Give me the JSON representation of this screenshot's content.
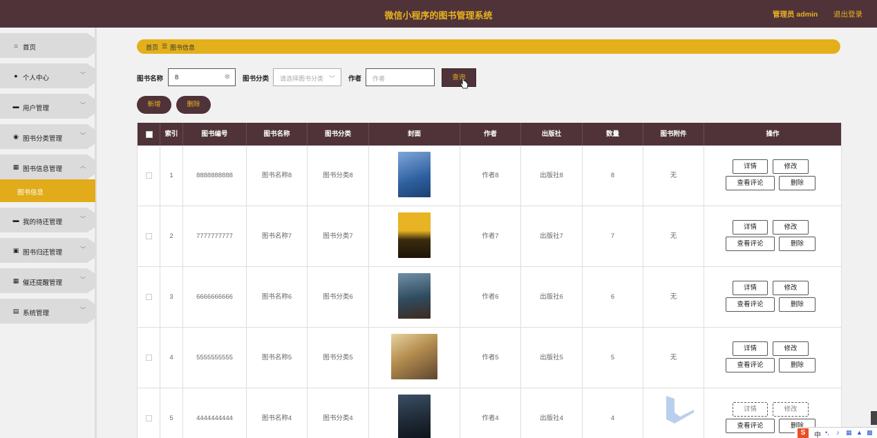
{
  "header": {
    "title": "微信小程序的图书管理系统",
    "admin_label": "管理员 admin",
    "logout_label": "退出登录"
  },
  "sidebar": {
    "items": [
      {
        "label": "首页",
        "icon": "home-icon",
        "glyph": "⌂",
        "has_chevron": false
      },
      {
        "label": "个人中心",
        "icon": "user-icon",
        "glyph": "●",
        "has_chevron": true
      },
      {
        "label": "用户管理",
        "icon": "monitor-icon",
        "glyph": "▬",
        "has_chevron": true
      },
      {
        "label": "图书分类管理",
        "icon": "pin-icon",
        "glyph": "◉",
        "has_chevron": true
      },
      {
        "label": "图书信息管理",
        "icon": "grid-icon",
        "glyph": "▦",
        "has_chevron": true,
        "expanded": true
      },
      {
        "label": "我的待还管理",
        "icon": "comment-icon",
        "glyph": "▬",
        "has_chevron": true
      },
      {
        "label": "图书归还管理",
        "icon": "clipboard-icon",
        "glyph": "▣",
        "has_chevron": true
      },
      {
        "label": "催还提醒管理",
        "icon": "apps-icon",
        "glyph": "▦",
        "has_chevron": true
      },
      {
        "label": "系统管理",
        "icon": "document-icon",
        "glyph": "▤",
        "has_chevron": true
      }
    ],
    "active_sub": "图书信息"
  },
  "breadcrumb": {
    "home": "首页",
    "separator": "☰",
    "current": "图书信息"
  },
  "filters": {
    "name_label": "图书名称",
    "name_value": "8",
    "category_label": "图书分类",
    "category_placeholder": "请选择图书分类",
    "author_label": "作者",
    "author_placeholder": "作者",
    "search_label": "查询"
  },
  "actions": {
    "add_label": "新增",
    "delete_label": "删除"
  },
  "table": {
    "columns": [
      "索引",
      "图书编号",
      "图书名称",
      "图书分类",
      "封面",
      "作者",
      "出版社",
      "数量",
      "图书附件",
      "操作"
    ],
    "rows": [
      {
        "index": "1",
        "code": "8888888888",
        "name": "图书名称8",
        "category": "图书分类8",
        "author": "作者8",
        "publisher": "出版社8",
        "qty": "8",
        "attachment": "无",
        "cover_color": "#3a6fb0"
      },
      {
        "index": "2",
        "code": "7777777777",
        "name": "图书名称7",
        "category": "图书分类7",
        "author": "作者7",
        "publisher": "出版社7",
        "qty": "7",
        "attachment": "无",
        "cover_color": "#d9a21a"
      },
      {
        "index": "3",
        "code": "6666666666",
        "name": "图书名称6",
        "category": "图书分类6",
        "author": "作者6",
        "publisher": "出版社6",
        "qty": "6",
        "attachment": "无",
        "cover_color": "#2f4b5e"
      },
      {
        "index": "4",
        "code": "5555555555",
        "name": "图书名称5",
        "category": "图书分类5",
        "author": "作者5",
        "publisher": "出版社5",
        "qty": "5",
        "attachment": "无",
        "cover_color": "#8a6a45"
      },
      {
        "index": "5",
        "code": "4444444444",
        "name": "图书名称4",
        "category": "图书分类4",
        "author": "作者4",
        "publisher": "出版社4",
        "qty": "4",
        "attachment": "",
        "cover_color": "#1f2a36"
      }
    ],
    "op_labels": {
      "detail": "详情",
      "edit": "修改",
      "comments": "查看评论",
      "delete": "删除"
    }
  },
  "ime_bar": {
    "lang": "中"
  },
  "colors": {
    "brand_dark": "#4f3339",
    "accent": "#e3b01c"
  }
}
